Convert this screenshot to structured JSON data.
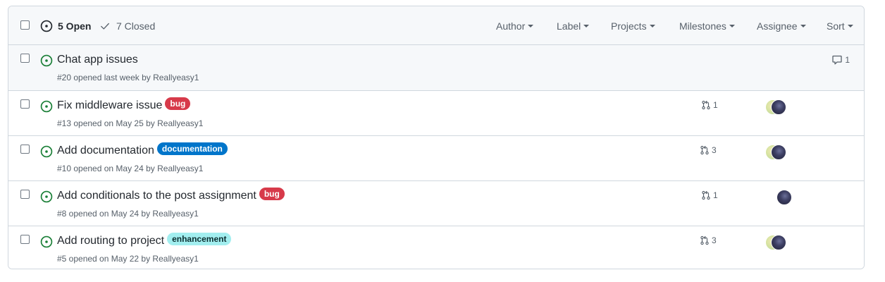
{
  "header": {
    "open_count": "5 Open",
    "closed_count": "7 Closed",
    "filters": [
      "Author",
      "Label",
      "Projects",
      "Milestones",
      "Assignee",
      "Sort"
    ]
  },
  "issues": [
    {
      "title": "Chat app issues",
      "label": "",
      "meta": "#20 opened last week by Reallyeasy1",
      "comments": "1",
      "prs": "",
      "assignees": 0
    },
    {
      "title": "Fix middleware issue",
      "label": "bug",
      "meta": "#13 opened on May 25 by Reallyeasy1",
      "comments": "",
      "prs": "1",
      "assignees": 2
    },
    {
      "title": "Add documentation",
      "label": "documentation",
      "meta": "#10 opened on May 24 by Reallyeasy1",
      "comments": "",
      "prs": "3",
      "assignees": 2
    },
    {
      "title": "Add conditionals to the post assignment",
      "label": "bug",
      "meta": "#8 opened on May 24 by Reallyeasy1",
      "comments": "",
      "prs": "1",
      "assignees": 1
    },
    {
      "title": "Add routing to project",
      "label": "enhancement",
      "meta": "#5 opened on May 22 by Reallyeasy1",
      "comments": "",
      "prs": "3",
      "assignees": 2
    }
  ],
  "label_colors": {
    "bug": {
      "bg": "#d73a4a",
      "fg": "#ffffff"
    },
    "documentation": {
      "bg": "#0075ca",
      "fg": "#ffffff"
    },
    "enhancement": {
      "bg": "#a2eeef",
      "fg": "#0b2e30"
    }
  },
  "colors": {
    "open_green": "#1a7f37",
    "muted": "#57606a",
    "border": "#d0d7de"
  },
  "icons": {
    "open": "issue-opened-icon",
    "closed": "check-icon",
    "pr": "git-pull-request-icon",
    "comment": "comment-icon"
  }
}
